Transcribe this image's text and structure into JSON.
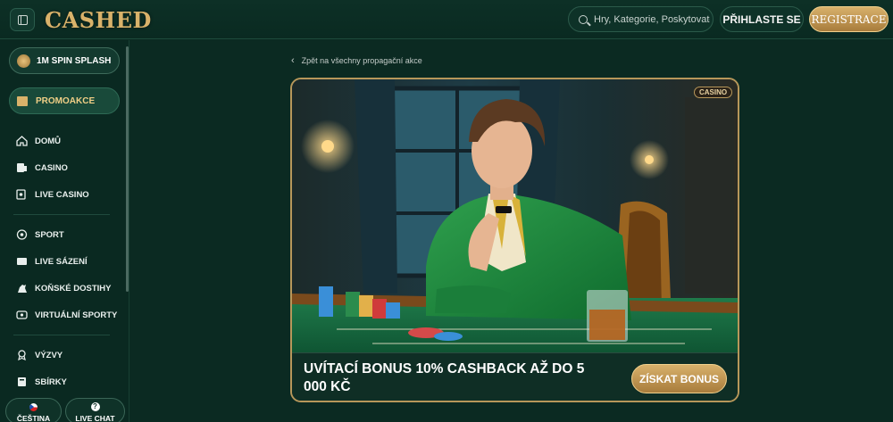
{
  "header": {
    "logo": "CASHED",
    "search_placeholder": "Hry, Kategorie, Poskytovatelé",
    "login_label": "PŘIHLASTE SE",
    "register_label": "REGISTRACE"
  },
  "sidebar": {
    "spin_label": "1M SPIN SPLASH",
    "promo_label": "PROMOAKCE",
    "items": [
      {
        "label": "DOMŮ",
        "icon": "home-icon"
      },
      {
        "label": "CASINO",
        "icon": "cards-icon"
      },
      {
        "label": "LIVE CASINO",
        "icon": "live-cards-icon"
      },
      {
        "label": "SPORT",
        "icon": "soccer-ball-icon"
      },
      {
        "label": "LIVE SÁZENÍ",
        "icon": "live-badge-icon"
      },
      {
        "label": "KOŇSKÉ DOSTIHY",
        "icon": "horse-icon"
      },
      {
        "label": "VIRTUÁLNÍ SPORTY",
        "icon": "virtual-sports-icon"
      },
      {
        "label": "VÝZVY",
        "icon": "medal-icon"
      },
      {
        "label": "SBÍRKY",
        "icon": "collection-icon"
      }
    ],
    "language_label": "ČEŠTINA",
    "chat_label": "LIVE CHAT"
  },
  "main": {
    "back_link": "Zpět na všechny propagační akce",
    "promo": {
      "badge": "CASINO",
      "title": "UVÍTACÍ BONUS 10% CASHBACK AŽ DO 5 000 KČ",
      "button_label": "ZÍSKAT BONUS"
    }
  },
  "colors": {
    "background": "#0b2a22",
    "gold": "#d9b26a",
    "accent_text": "#f0cf86"
  }
}
